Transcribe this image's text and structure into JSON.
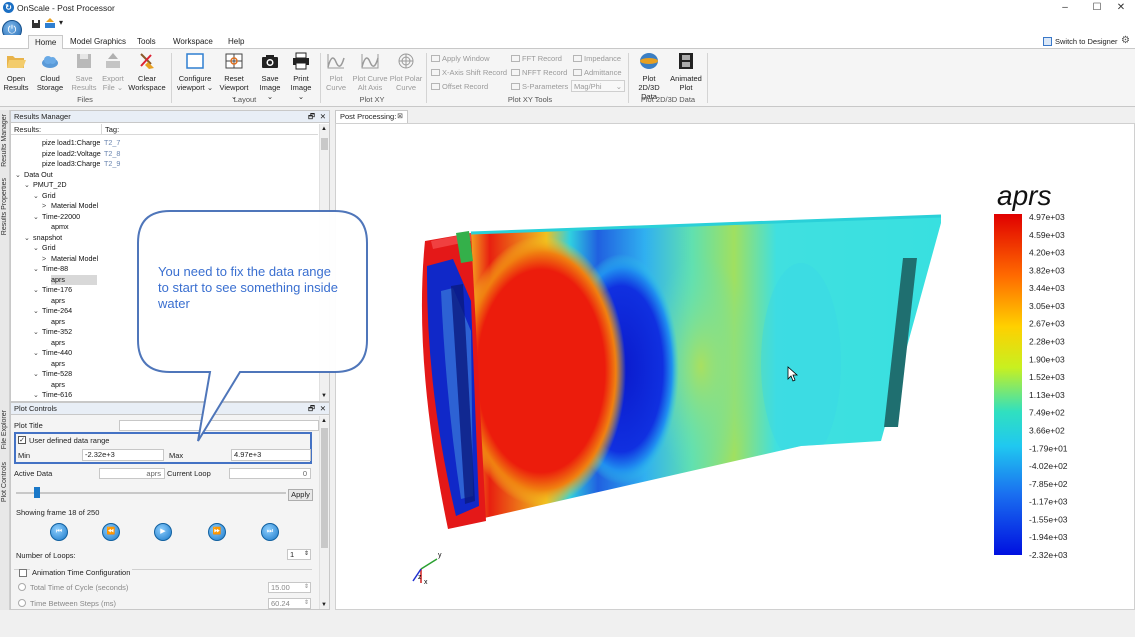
{
  "window": {
    "title": "OnScale - Post Processor"
  },
  "tabs": [
    "Home",
    "Model Graphics",
    "Tools",
    "Workspace",
    "Help"
  ],
  "switch_designer": "Switch to Designer",
  "ribbon": {
    "files": {
      "group": "Files",
      "open": [
        "Open",
        "Results"
      ],
      "cloud": [
        "Cloud",
        "Storage"
      ],
      "save": [
        "Save",
        "Results"
      ],
      "export": [
        "Export",
        "File ⌄"
      ],
      "clear": [
        "Clear",
        "Workspace"
      ]
    },
    "layout": {
      "group": "Layout",
      "configure": [
        "Configure",
        "viewport ⌄"
      ],
      "reset": [
        "Reset",
        "Viewport ⌄"
      ],
      "saveimg": [
        "Save",
        "Image ⌄"
      ],
      "print": [
        "Print",
        "Image ⌄"
      ]
    },
    "plotxy": {
      "group": "Plot XY",
      "plot": [
        "Plot",
        "Curve"
      ],
      "alt": [
        "Plot Curve",
        "Alt Axis"
      ],
      "polar": [
        "Plot Polar",
        "Curve"
      ]
    },
    "tools": {
      "group": "Plot XY Tools",
      "apply_window": "Apply Window",
      "xshift": "X-Axis Shift Record",
      "offset": "Offset Record",
      "fft": "FFT Record",
      "nfft": "NFFT Record",
      "sparams": "S-Parameters",
      "impedance": "Impedance",
      "admittance": "Admittance",
      "magphi": "Mag/Phi"
    },
    "plot2d3d": {
      "group": "Plot 2D/3D Data",
      "plot": [
        "Plot 2D/3D",
        "Data"
      ],
      "anim": [
        "Animated",
        "Plot"
      ]
    }
  },
  "results_manager": {
    "title": "Results Manager",
    "col_results": "Results:",
    "col_tag": "Tag:",
    "rows": [
      {
        "indent": 2,
        "text": "pize load1:Charge",
        "tag": "T2_7"
      },
      {
        "indent": 2,
        "text": "pize load2:Voltage",
        "tag": "T2_8"
      },
      {
        "indent": 2,
        "text": "pize load3:Charge",
        "tag": "T2_9"
      },
      {
        "indent": 0,
        "text": "Data Out",
        "arrow": "⌄"
      },
      {
        "indent": 1,
        "text": "PMUT_2D",
        "arrow": "⌄"
      },
      {
        "indent": 2,
        "text": "Grid",
        "arrow": "⌄"
      },
      {
        "indent": 3,
        "text": "Material Model",
        "arrow": ">"
      },
      {
        "indent": 2,
        "text": "Time-22000",
        "arrow": "⌄"
      },
      {
        "indent": 3,
        "text": "apmx"
      },
      {
        "indent": 1,
        "text": "snapshot",
        "arrow": "⌄"
      },
      {
        "indent": 2,
        "text": "Grid",
        "arrow": "⌄"
      },
      {
        "indent": 3,
        "text": "Material Model",
        "arrow": ">"
      },
      {
        "indent": 2,
        "text": "Time-88",
        "arrow": "⌄"
      },
      {
        "indent": 3,
        "text": "aprs",
        "selected": true
      },
      {
        "indent": 2,
        "text": "Time-176",
        "arrow": "⌄"
      },
      {
        "indent": 3,
        "text": "aprs"
      },
      {
        "indent": 2,
        "text": "Time-264",
        "arrow": "⌄"
      },
      {
        "indent": 3,
        "text": "aprs"
      },
      {
        "indent": 2,
        "text": "Time-352",
        "arrow": "⌄"
      },
      {
        "indent": 3,
        "text": "aprs"
      },
      {
        "indent": 2,
        "text": "Time-440",
        "arrow": "⌄"
      },
      {
        "indent": 3,
        "text": "aprs"
      },
      {
        "indent": 2,
        "text": "Time-528",
        "arrow": "⌄"
      },
      {
        "indent": 3,
        "text": "aprs"
      },
      {
        "indent": 2,
        "text": "Time-616",
        "arrow": "⌄"
      }
    ]
  },
  "side_tabs_top": [
    "Results Manager",
    "Results Properties"
  ],
  "side_tabs_bottom": [
    "File Explorer",
    "Plot Controls"
  ],
  "plot_controls": {
    "title": "Plot Controls",
    "plot_title_label": "Plot Title",
    "user_range_label": "User defined data range",
    "min_label": "Min",
    "min_value": "-2.32e+3",
    "max_label": "Max",
    "max_value": "4.97e+3",
    "active_data_label": "Active Data",
    "active_data_value": "aprs",
    "current_loop_label": "Current Loop",
    "current_loop_value": "0",
    "apply": "Apply",
    "frame_status": "Showing frame 18 of 250",
    "loops_label": "Number of Loops:",
    "loops_value": "1",
    "anim_config": "Animation Time Configuration",
    "total_time_label": "Total Time of Cycle (seconds)",
    "total_time_value": "15.00",
    "between_label": "Time Between Steps (ms)",
    "between_value": "60.24"
  },
  "doc_tab": "Post Processing:",
  "callout": "You need to fix the data range to start to see something inside water",
  "legend": {
    "title": "aprs",
    "labels": [
      "4.97e+03",
      "4.59e+03",
      "4.20e+03",
      "3.82e+03",
      "3.44e+03",
      "3.05e+03",
      "2.67e+03",
      "2.28e+03",
      "1.90e+03",
      "1.52e+03",
      "1.13e+03",
      "7.49e+02",
      "3.66e+02",
      "-1.79e+01",
      "-4.02e+02",
      "-7.85e+02",
      "-1.17e+03",
      "-1.55e+03",
      "-1.94e+03",
      "-2.32e+03"
    ]
  },
  "axes": {
    "x": "x",
    "y": "y",
    "z": "z"
  }
}
